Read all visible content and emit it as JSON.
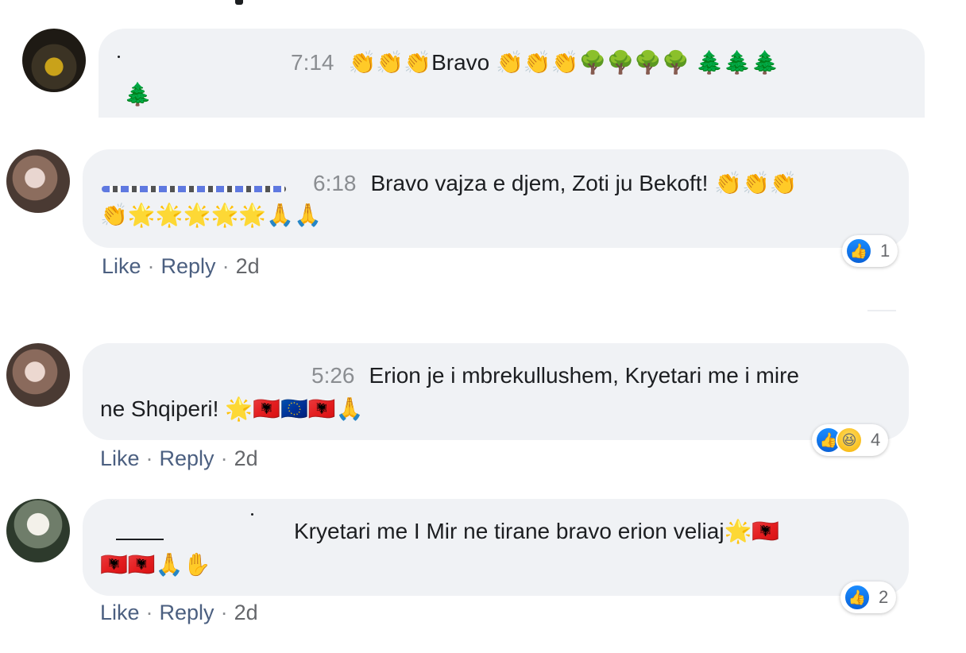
{
  "comments": [
    {
      "time": "7:14",
      "line1": "👏👏👏Bravo 👏👏👏🌳🌳🌳🌳 🌲🌲🌲",
      "line2": "🌲"
    },
    {
      "time": "6:18",
      "line1": "Bravo vajza e djem, Zoti ju Bekoft! 👏👏👏",
      "line2": "👏🌟🌟🌟🌟🌟🙏🙏",
      "actions": {
        "like": "Like",
        "reply": "Reply",
        "age": "2d",
        "sep": "·"
      },
      "reactions": {
        "count": "1",
        "types": [
          "like-icon"
        ]
      }
    },
    {
      "time": "5:26",
      "line1": "Erion je i mbrekullushem, Kryetari me i mire",
      "line2": "ne Shqiperi! 🌟🇦🇱🇪🇺🇦🇱🙏",
      "actions": {
        "like": "Like",
        "reply": "Reply",
        "age": "2d",
        "sep": "·"
      },
      "reactions": {
        "count": "4",
        "types": [
          "like-icon",
          "haha-icon"
        ]
      }
    },
    {
      "line1": "Kryetari me I Mir ne tirane bravo erion veliaj🌟🇦🇱",
      "line2": "🇦🇱🇦🇱🙏✋",
      "actions": {
        "like": "Like",
        "reply": "Reply",
        "age": "2d",
        "sep": "·"
      },
      "reactions": {
        "count": "2",
        "types": [
          "like-icon"
        ]
      }
    }
  ],
  "icons": {
    "like": "👍",
    "haha": "😆"
  }
}
